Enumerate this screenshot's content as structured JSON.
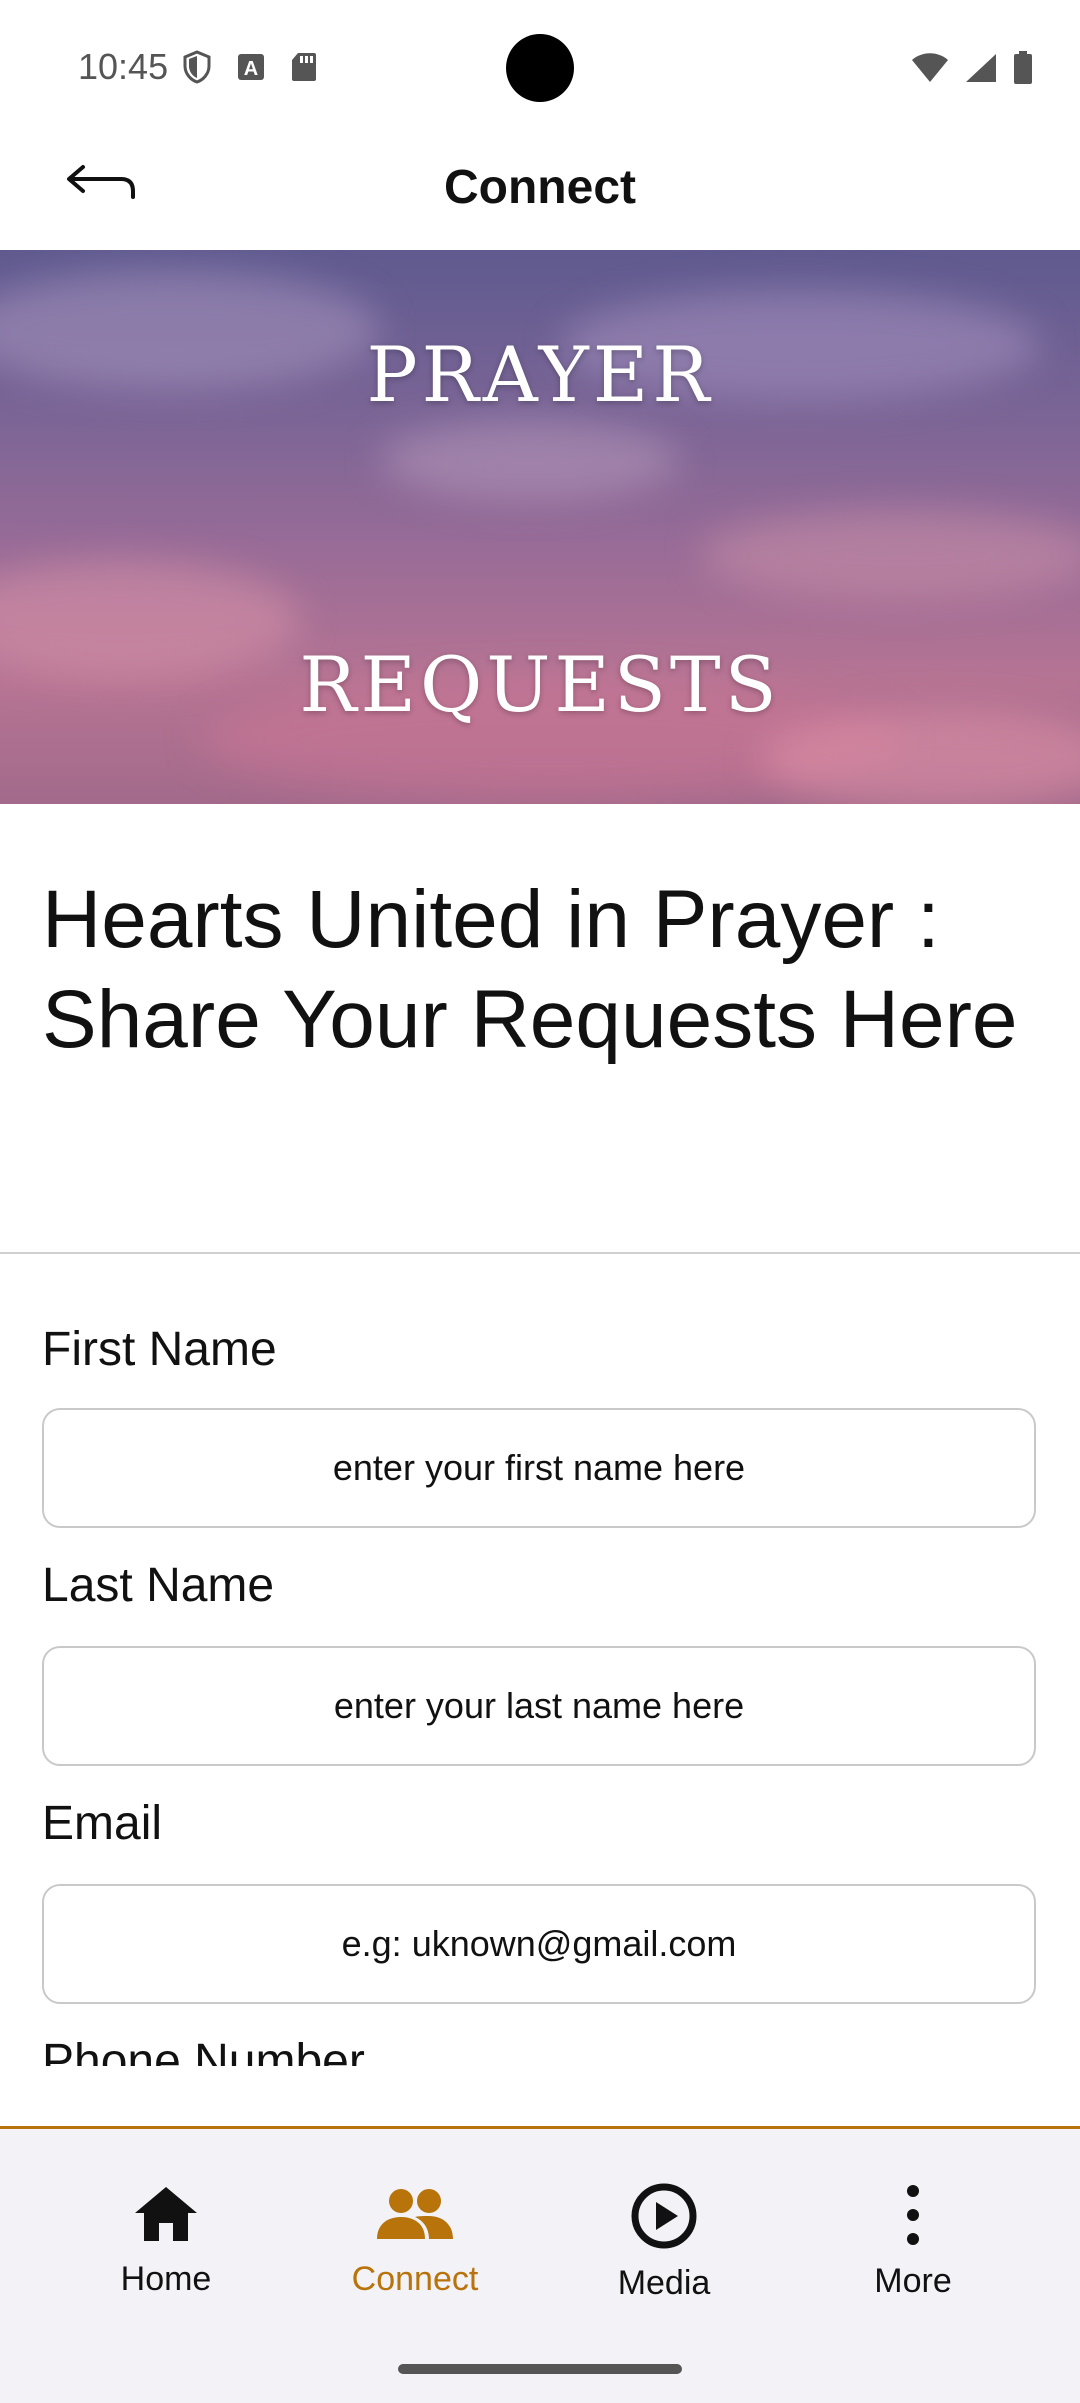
{
  "status_bar": {
    "time": "10:45"
  },
  "app_bar": {
    "title": "Connect"
  },
  "hero": {
    "line1": "PRAYER",
    "line2": "REQUESTS"
  },
  "heading": "Hearts United in Prayer : Share Your Requests Here",
  "form": {
    "first_name": {
      "label": "First Name",
      "placeholder": "enter your first name here",
      "value": ""
    },
    "last_name": {
      "label": "Last Name",
      "placeholder": "enter your last name here",
      "value": ""
    },
    "email": {
      "label": "Email",
      "placeholder": "e.g: uknown@gmail.com",
      "value": ""
    },
    "phone": {
      "label": "Phone Number"
    }
  },
  "bottom_nav": {
    "items": [
      {
        "label": "Home",
        "icon": "home-icon"
      },
      {
        "label": "Connect",
        "icon": "people-icon",
        "active": true
      },
      {
        "label": "Media",
        "icon": "play-circle-icon"
      },
      {
        "label": "More",
        "icon": "more-vertical-icon"
      }
    ],
    "active_color": "#b8730a"
  },
  "colors": {
    "accent": "#b8730a",
    "nav_background": "#f3f2f7"
  }
}
